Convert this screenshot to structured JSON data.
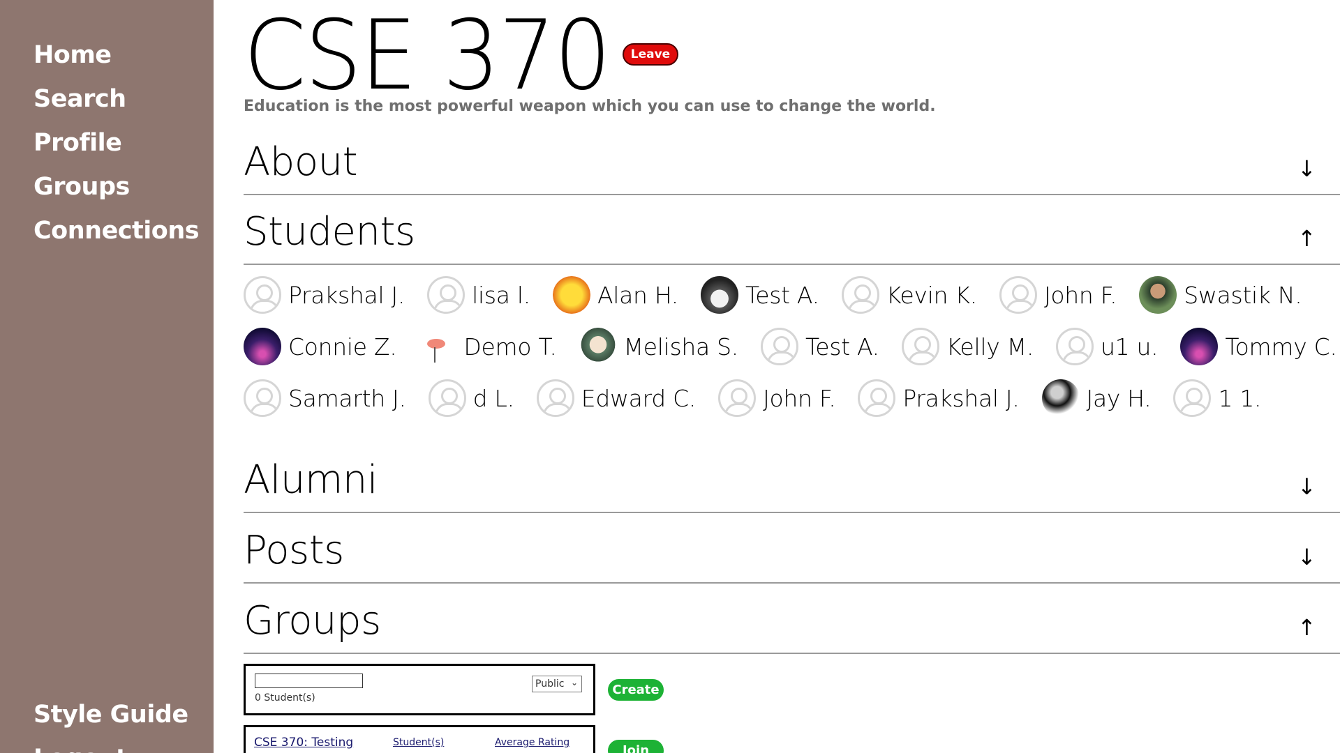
{
  "sidebar": {
    "nav": [
      "Home",
      "Search",
      "Profile",
      "Groups",
      "Connections"
    ],
    "bottom": [
      "Style Guide",
      "Logout"
    ]
  },
  "header": {
    "title": "CSE 370",
    "leave_label": "Leave",
    "subtitle": "Education is the most powerful weapon which you can use to change the world."
  },
  "sections": {
    "about": {
      "title": "About",
      "arrow": "↓"
    },
    "students": {
      "title": "Students",
      "arrow": "↑"
    },
    "alumni": {
      "title": "Alumni",
      "arrow": "↓"
    },
    "posts": {
      "title": "Posts",
      "arrow": "↓"
    },
    "groups": {
      "title": "Groups",
      "arrow": "↑"
    }
  },
  "students": [
    [
      {
        "name": "Prakshal J.",
        "avatar": "default"
      },
      {
        "name": "lisa l.",
        "avatar": "default"
      },
      {
        "name": "Alan H.",
        "avatar": "boom"
      },
      {
        "name": "Test A.",
        "avatar": "car"
      },
      {
        "name": "Kevin K.",
        "avatar": "default"
      },
      {
        "name": "John F.",
        "avatar": "default"
      },
      {
        "name": "Swastik N.",
        "avatar": "photo-man"
      }
    ],
    [
      {
        "name": "Connie Z.",
        "avatar": "city"
      },
      {
        "name": "Demo T.",
        "avatar": "flamingo"
      },
      {
        "name": "Melisha S.",
        "avatar": "cartoon"
      },
      {
        "name": "Test A.",
        "avatar": "default"
      },
      {
        "name": "Kelly M.",
        "avatar": "default"
      },
      {
        "name": "u1 u.",
        "avatar": "default"
      },
      {
        "name": "Tommy C.",
        "avatar": "city"
      }
    ],
    [
      {
        "name": "Samarth J.",
        "avatar": "default"
      },
      {
        "name": "d L.",
        "avatar": "default"
      },
      {
        "name": "Edward C.",
        "avatar": "default"
      },
      {
        "name": "John F.",
        "avatar": "default"
      },
      {
        "name": "Prakshal J.",
        "avatar": "default"
      },
      {
        "name": "Jay H.",
        "avatar": "portrait"
      },
      {
        "name": "1 1.",
        "avatar": "default"
      }
    ]
  ],
  "groups": {
    "new_group": {
      "name_value": "",
      "visibility": "Public",
      "student_count": "0 Student(s)",
      "create_label": "Create"
    },
    "existing": [
      {
        "name": "CSE 370: Testing",
        "students_label": "Student(s)",
        "rating_label": "Average Rating",
        "join_label": "Join"
      }
    ]
  }
}
